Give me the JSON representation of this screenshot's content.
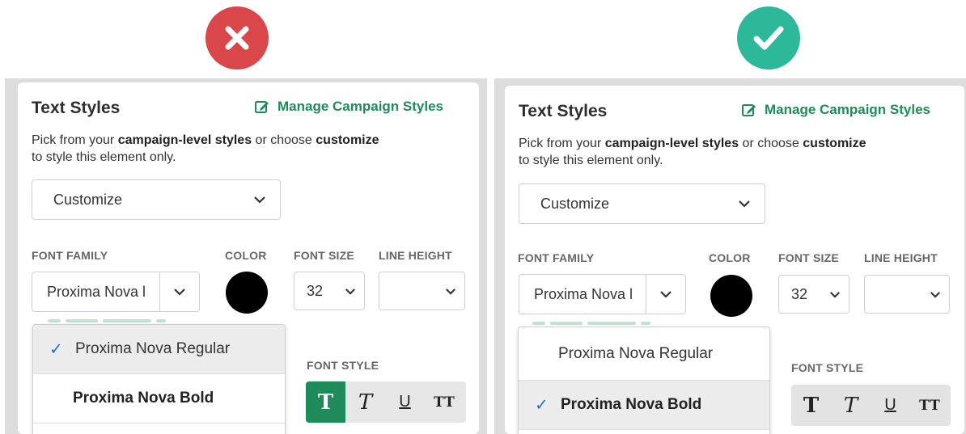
{
  "badges": {
    "bad_icon": "x-icon",
    "good_icon": "check-icon",
    "bad_color": "#d9474a",
    "good_color": "#2db89a"
  },
  "panel": {
    "title": "Text Styles",
    "manage_label": "Manage Campaign Styles",
    "desc_1": "Pick from your ",
    "desc_b1": "campaign-level styles",
    "desc_2": " or choose ",
    "desc_b2": "customize",
    "desc_3": "to style this element only.",
    "style_select": "Customize",
    "labels": {
      "font_family": "FONT FAMILY",
      "color": "COLOR",
      "font_size": "FONT SIZE",
      "line_height": "LINE HEIGHT",
      "font_style": "FONT STYLE"
    },
    "font_family_value": "Proxima Nova l",
    "font_size_value": "32",
    "line_height_value": "",
    "color_value": "#000000",
    "accent_color": "#1f8a5a",
    "style_buttons": [
      "T",
      "T",
      "U",
      "TT"
    ],
    "font_options": [
      "Proxima Nova Regular",
      "Proxima Nova Bold"
    ],
    "check_mark": "✓"
  }
}
